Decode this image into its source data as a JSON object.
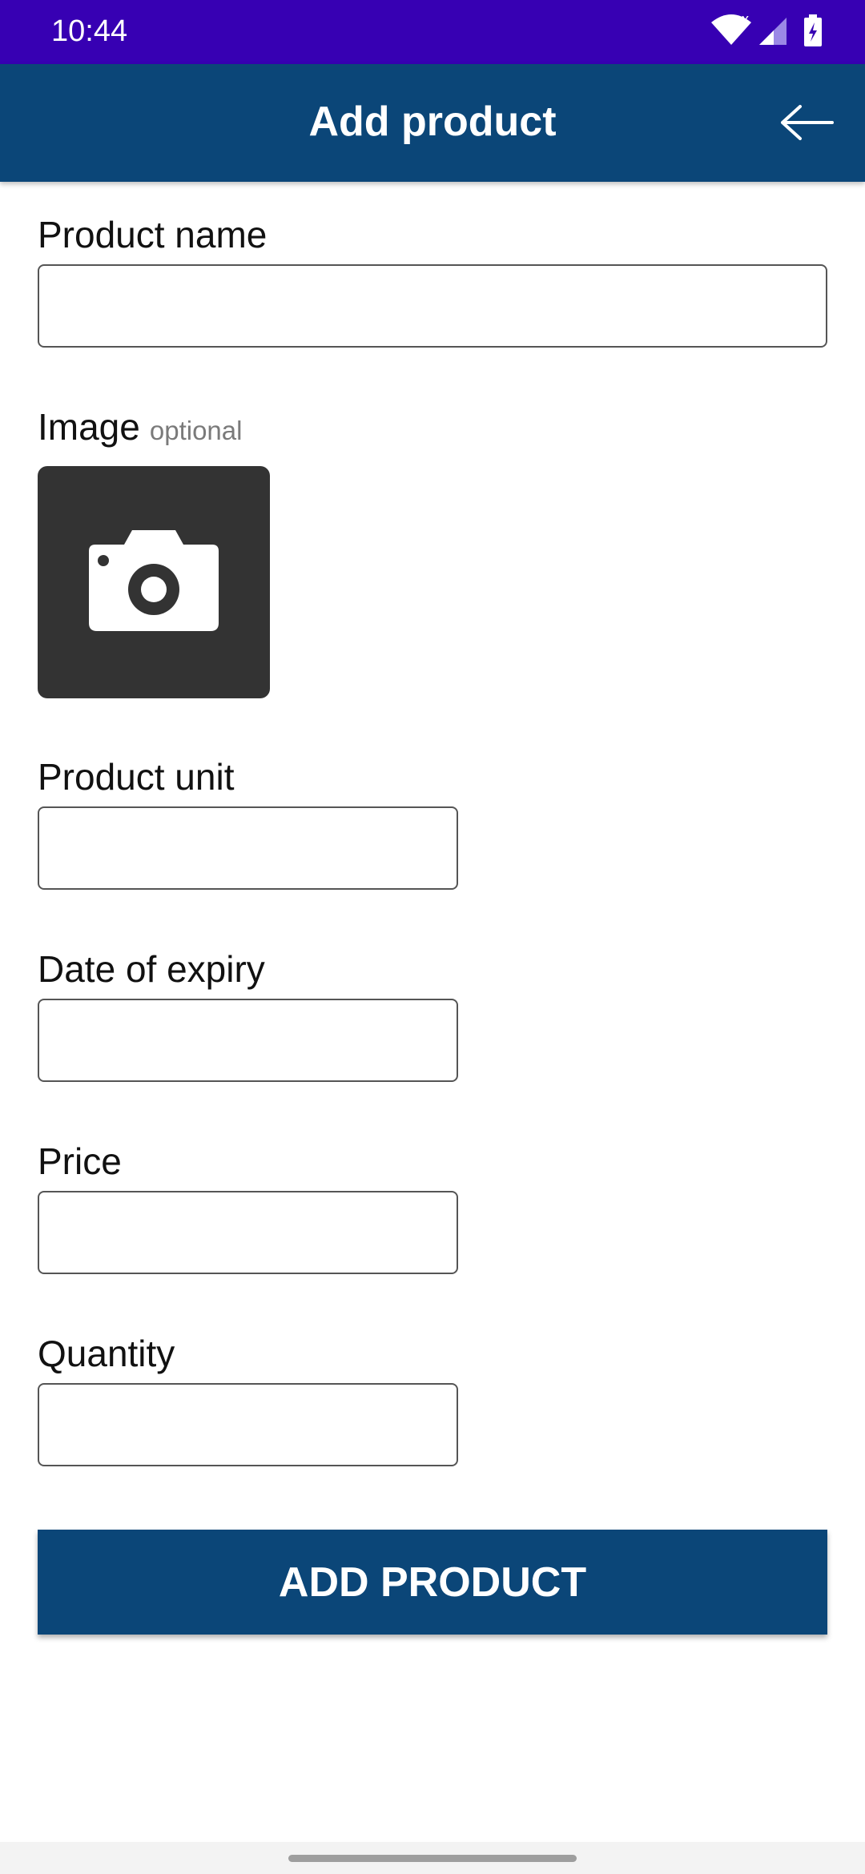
{
  "status_bar": {
    "time": "10:44",
    "icons": [
      "wifi-icon",
      "cellular-signal-icon",
      "battery-charging-icon"
    ]
  },
  "app_bar": {
    "title": "Add product",
    "back_icon": "arrow-left-icon"
  },
  "form": {
    "product_name": {
      "label": "Product name",
      "value": "",
      "placeholder": ""
    },
    "image": {
      "label": "Image",
      "note": "optional",
      "icon": "camera-icon"
    },
    "product_unit": {
      "label": "Product unit",
      "value": "",
      "placeholder": ""
    },
    "date_of_expiry": {
      "label": "Date of expiry",
      "value": "",
      "placeholder": ""
    },
    "price": {
      "label": "Price",
      "value": "",
      "placeholder": ""
    },
    "quantity": {
      "label": "Quantity",
      "value": "",
      "placeholder": ""
    }
  },
  "submit_label": "ADD PRODUCT",
  "colors": {
    "status_bar": "#3700b3",
    "app_bar": "#0b4678",
    "button": "#0b4678",
    "image_picker": "#333333"
  }
}
